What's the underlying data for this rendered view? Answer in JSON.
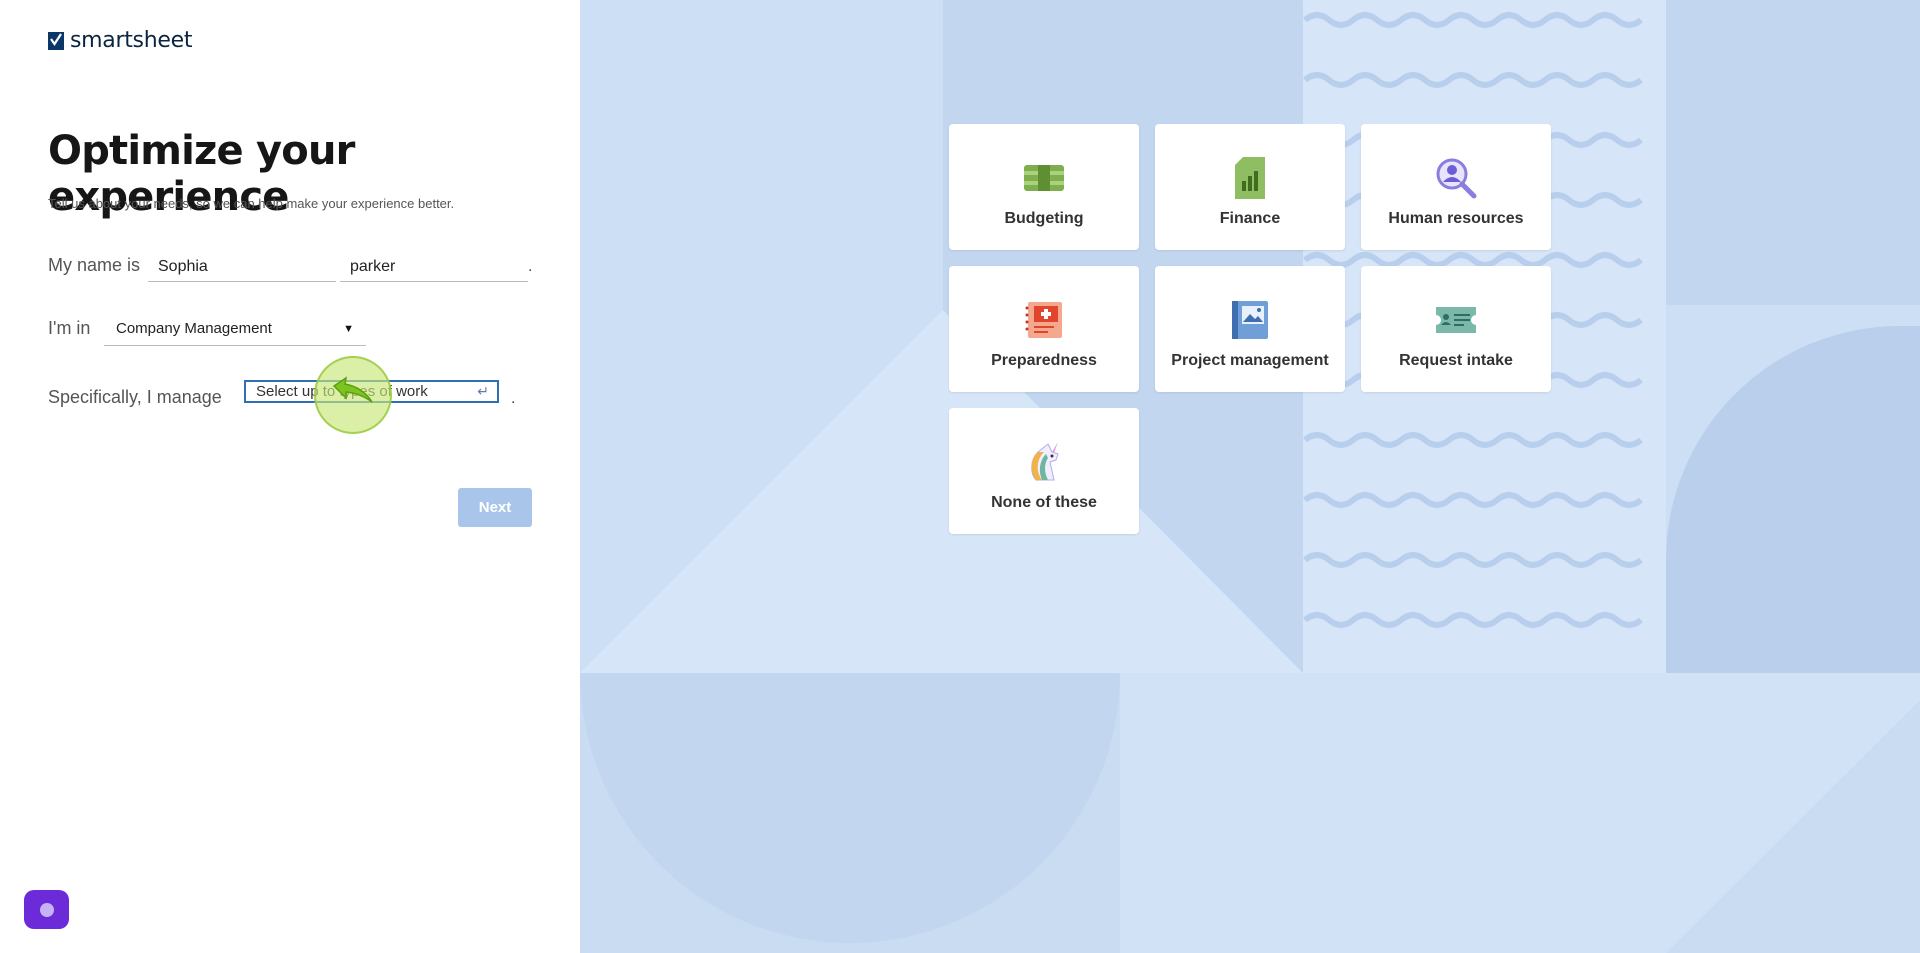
{
  "brand": {
    "name": "smartsheet"
  },
  "form": {
    "title": "Optimize your experience",
    "subtitle": "Tell us about your needs, so we can help make your experience better.",
    "name_label": "My name is",
    "first_name": "Sophia",
    "last_name": "parker",
    "period": ".",
    "industry_label": "I'm in",
    "industry_value": "Company Management",
    "manage_label": "Specifically, I manage",
    "manage_placeholder": "Select up to 3 types of work",
    "manage_visible_text": "Select up to types of work",
    "next_label": "Next"
  },
  "work_types": [
    {
      "label": "Budgeting",
      "icon": "money-stack-icon"
    },
    {
      "label": "Finance",
      "icon": "finance-doc-icon"
    },
    {
      "label": "Human resources",
      "icon": "person-search-icon"
    },
    {
      "label": "Preparedness",
      "icon": "first-aid-notebook-icon"
    },
    {
      "label": "Project management",
      "icon": "image-notebook-icon"
    },
    {
      "label": "Request intake",
      "icon": "ticket-icon"
    },
    {
      "label": "None of these",
      "icon": "unicorn-icon"
    }
  ],
  "colors": {
    "accent": "#2f6fb5",
    "next_disabled": "#a9c6ea",
    "background_panel": "#cddff4",
    "chat_button": "#6c2bd9"
  }
}
